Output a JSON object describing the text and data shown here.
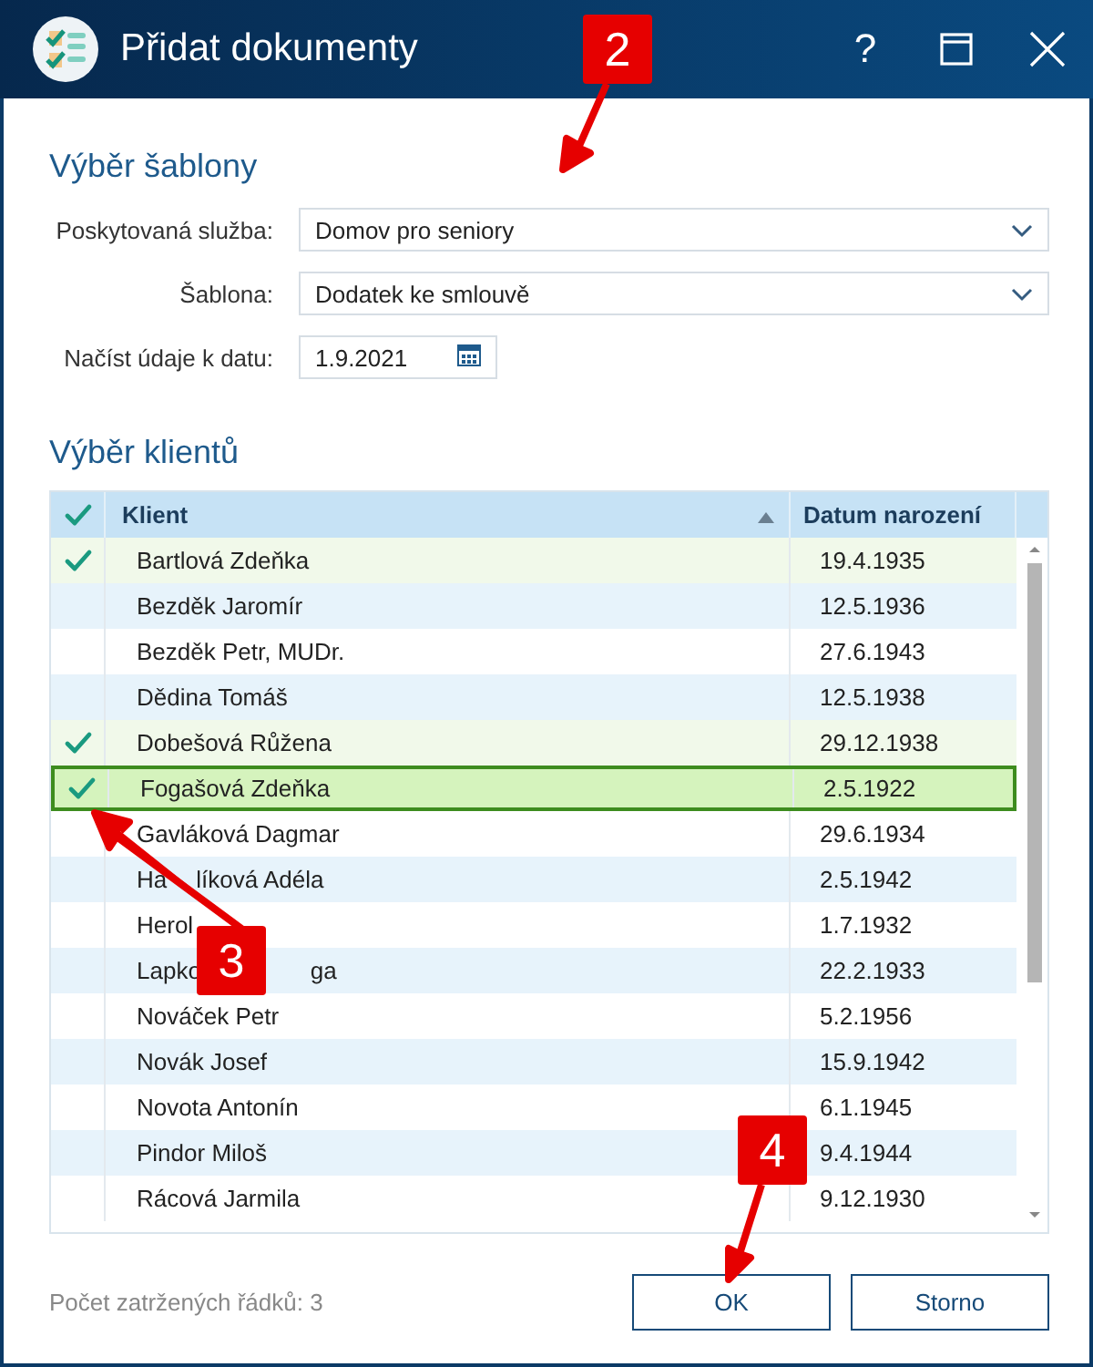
{
  "window": {
    "title": "Přidat dokumenty",
    "help": "?"
  },
  "template_section": {
    "title": "Výběr šablony",
    "fields": [
      {
        "kind": "select",
        "label": "Poskytovaná služba:",
        "value": "Domov pro seniory"
      },
      {
        "kind": "select",
        "label": "Šablona:",
        "value": "Dodatek ke smlouvě"
      },
      {
        "kind": "date",
        "label": "Načíst údaje k datu:",
        "value": "1.9.2021"
      }
    ]
  },
  "clients_section": {
    "title": "Výběr klientů",
    "table": {
      "columns": [
        {
          "kind": "check"
        },
        {
          "kind": "sorted",
          "label": "Klient"
        },
        {
          "kind": "text",
          "label": "Datum narození"
        }
      ],
      "rows": [
        {
          "name": "Bartlová Zdeňka",
          "date": "19.4.1935",
          "checked": true,
          "selected": false
        },
        {
          "name": "Bezděk Jaromír",
          "date": "12.5.1936",
          "checked": false,
          "selected": false
        },
        {
          "name": "Bezděk Petr, MUDr.",
          "date": "27.6.1943",
          "checked": false,
          "selected": false
        },
        {
          "name": "Dědina Tomáš",
          "date": "12.5.1938",
          "checked": false,
          "selected": false
        },
        {
          "name": "Dobešová Růžena",
          "date": "29.12.1938",
          "checked": true,
          "selected": false
        },
        {
          "name": "Fogašová Zdeňka",
          "date": "2.5.1922",
          "checked": true,
          "selected": true
        },
        {
          "name": "Gavláková Dagmar",
          "date": "29.6.1934",
          "checked": false,
          "selected": false
        },
        {
          "name": "Ha",
          "name_tail": "líková Adéla",
          "date": "2.5.1942",
          "checked": false,
          "selected": false
        },
        {
          "name": "Herol",
          "date": "1.7.1932",
          "checked": false,
          "selected": false
        },
        {
          "name": "Lapko",
          "name_tail": "ga",
          "date": "22.2.1933",
          "checked": false,
          "selected": false
        },
        {
          "name": "Nováček Petr",
          "date": "5.2.1956",
          "checked": false,
          "selected": false
        },
        {
          "name": "Novák Josef",
          "date": "15.9.1942",
          "checked": false,
          "selected": false
        },
        {
          "name": "Novota Antonín",
          "date": "6.1.1945",
          "checked": false,
          "selected": false
        },
        {
          "name": "Pindor Miloš",
          "date": "9.4.1944",
          "checked": false,
          "selected": false
        },
        {
          "name": "Rácová Jarmila",
          "date": "9.12.1930",
          "checked": false,
          "selected": false
        }
      ]
    }
  },
  "footer": {
    "count_text": "Počet zatržených řádků: 3",
    "buttons": [
      "OK",
      "Storno"
    ]
  },
  "annotations": [
    {
      "label": "2"
    },
    {
      "label": "3"
    },
    {
      "label": "4"
    }
  ]
}
